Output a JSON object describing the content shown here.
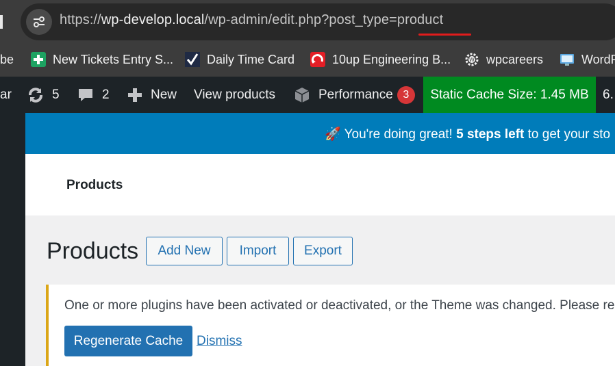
{
  "browser": {
    "url_scheme": "https://",
    "url_host": "wp-develop.local",
    "url_path": "/wp-admin/edit.php?post_type=",
    "url_highlight": "product"
  },
  "bookmarks": [
    {
      "label": "be",
      "icon": "partial-bookmark"
    },
    {
      "label": "New Tickets Entry S...",
      "icon": "sheets-plus-icon",
      "color": "#1ea362"
    },
    {
      "label": "Daily Time Card",
      "icon": "checkmark-icon"
    },
    {
      "label": "10up Engineering B...",
      "icon": "10up-icon",
      "color": "#e41e26"
    },
    {
      "label": "wpcareers",
      "icon": "wordpress-gear-icon"
    },
    {
      "label": "WordP",
      "icon": "wordpress-monitor-icon"
    }
  ],
  "adminbar": {
    "left_fragment": "ar",
    "updates_count": "5",
    "comments_count": "2",
    "new_label": "New",
    "view_products_label": "View products",
    "performance_label": "Performance",
    "performance_badge": "3",
    "static_cache_label": "Static Cache Size: 1.45 MB",
    "right_fragment": "6."
  },
  "promo": {
    "text_start": "You're doing great!",
    "text_bold": "5 steps left",
    "text_end": "to get your sto"
  },
  "header": {
    "title": "Products"
  },
  "page": {
    "title": "Products",
    "add_new": "Add New",
    "import": "Import",
    "export": "Export"
  },
  "notice": {
    "text": "One or more plugins have been activated or deactivated, or the Theme was changed. Please re",
    "regenerate_button": "Regenerate Cache",
    "dismiss_link": "Dismiss"
  },
  "colors": {
    "adminbar": "#1d2327",
    "promo": "#007cba",
    "static_cache": "#008a20",
    "notice_border": "#dba617",
    "primary": "#2271b1"
  }
}
